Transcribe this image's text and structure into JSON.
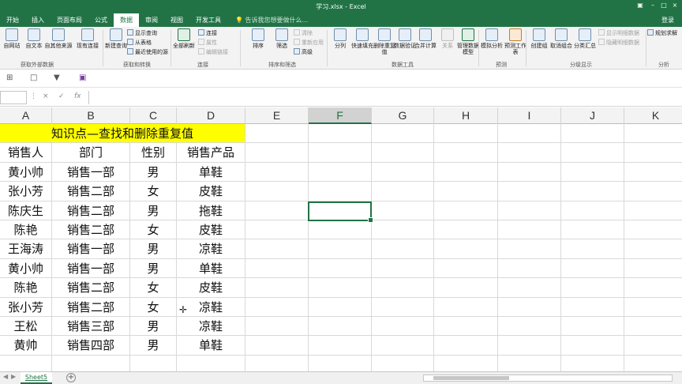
{
  "window": {
    "title": "学习.xlsx - Excel",
    "login": "登录"
  },
  "tabs": [
    "开始",
    "插入",
    "页面布局",
    "公式",
    "数据",
    "审阅",
    "视图",
    "开发工具"
  ],
  "active_tab": "数据",
  "tell_me": "告诉我您想要做什么...",
  "ribbon": {
    "buttons": [
      {
        "label": "自网站"
      },
      {
        "label": "自文本"
      },
      {
        "label": "自其他来源"
      },
      {
        "label": "现有连接"
      },
      {
        "label": "新建查询"
      },
      {
        "label": "全部刷新"
      },
      {
        "label": "排序"
      },
      {
        "label": "筛选"
      },
      {
        "label": "分列"
      },
      {
        "label": "快速填充"
      },
      {
        "label": "删除重复值"
      },
      {
        "label": "数据验证"
      },
      {
        "label": "合并计算"
      },
      {
        "label": "关系"
      },
      {
        "label": "管理数据模型"
      },
      {
        "label": "模拟分析"
      },
      {
        "label": "预测工作表"
      },
      {
        "label": "创建组"
      },
      {
        "label": "取消组合"
      },
      {
        "label": "分类汇总"
      },
      {
        "label": "规划求解"
      }
    ],
    "small": {
      "show_query": "显示查询",
      "from_table": "从表格",
      "recent_sources": "最近使用的源",
      "connections": "连接",
      "properties": "属性",
      "edit_links": "编辑链接",
      "clear": "清除",
      "reapply": "重新应用",
      "advanced": "高级",
      "show_detail": "显示明细数据",
      "hide_detail": "隐藏明细数据"
    },
    "groups": {
      "get_external": "获取外部数据",
      "get_transform": "获取和转换",
      "connections": "连接",
      "sort_filter": "排序和筛选",
      "data_tools": "数据工具",
      "forecast": "预测",
      "outline": "分级显示",
      "analysis": "分析"
    }
  },
  "formula_bar": {
    "cancel_icon": "×",
    "enter_icon": "✓",
    "fx": "fx"
  },
  "columns": [
    "A",
    "B",
    "C",
    "D",
    "E",
    "F",
    "G",
    "H",
    "I",
    "J",
    "K"
  ],
  "selected_column": "F",
  "sheet": {
    "title": "知识点—查找和删除重复值",
    "headers": [
      "销售人",
      "部门",
      "性别",
      "销售产品"
    ],
    "rows": [
      [
        "黄小帅",
        "销售一部",
        "男",
        "单鞋"
      ],
      [
        "张小芳",
        "销售二部",
        "女",
        "皮鞋"
      ],
      [
        "陈庆生",
        "销售二部",
        "男",
        "拖鞋"
      ],
      [
        "陈艳",
        "销售二部",
        "女",
        "皮鞋"
      ],
      [
        "王海涛",
        "销售一部",
        "男",
        "凉鞋"
      ],
      [
        "黄小帅",
        "销售一部",
        "男",
        "单鞋"
      ],
      [
        "陈艳",
        "销售二部",
        "女",
        "皮鞋"
      ],
      [
        "张小芳",
        "销售二部",
        "女",
        "凉鞋"
      ],
      [
        "王松",
        "销售三部",
        "男",
        "凉鞋"
      ],
      [
        "黄帅",
        "销售四部",
        "男",
        "单鞋"
      ]
    ],
    "tab_name": "Sheet5"
  },
  "colors": {
    "accent": "#217346",
    "title_fill": "#ffff00"
  }
}
